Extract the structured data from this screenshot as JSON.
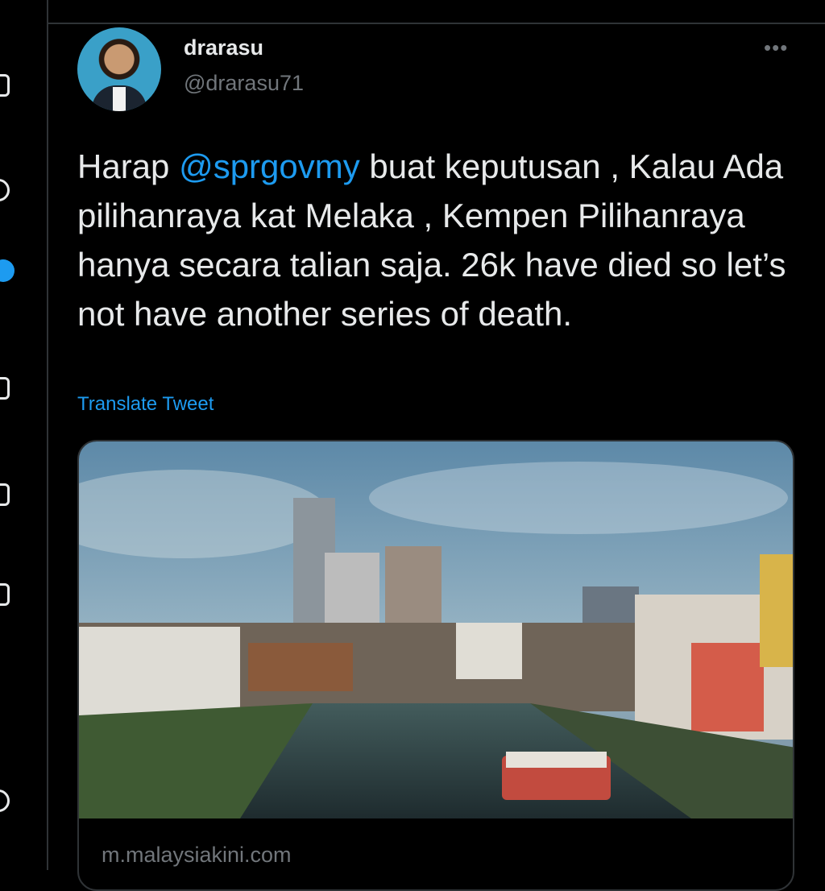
{
  "tweet": {
    "display_name": "drarasu",
    "handle": "@drarasu71",
    "more_label": "•••",
    "text_before": "Harap ",
    "mention": "@sprgovmy",
    "text_after": " buat keputusan , Kalau Ada pilihanraya kat Melaka , Kempen Pilihanraya hanya secara talian saja. 26k have died so let’s not have another series of death.",
    "translate_label": "Translate Tweet"
  },
  "card": {
    "domain": "m.malaysiakini.com"
  },
  "icons": {
    "avatar": "profile-photo",
    "more": "more-options-icon",
    "image": "melaka-river-photo"
  },
  "colors": {
    "background": "#000000",
    "text": "#e7e9ea",
    "secondary": "#71767b",
    "accent": "#1d9bf0",
    "border": "#2f3336"
  }
}
